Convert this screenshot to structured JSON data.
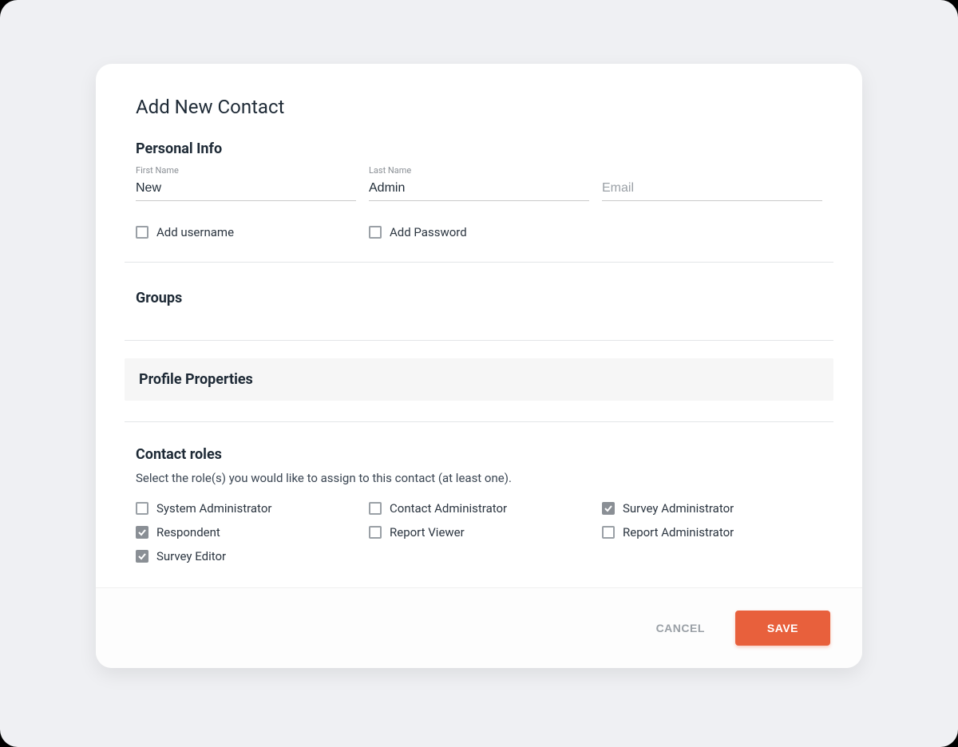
{
  "title": "Add New Contact",
  "sections": {
    "personal_info": "Personal Info",
    "groups": "Groups",
    "profile_properties": "Profile Properties",
    "contact_roles": "Contact roles"
  },
  "fields": {
    "first_name": {
      "label": "First Name",
      "value": "New"
    },
    "last_name": {
      "label": "Last Name",
      "value": "Admin"
    },
    "email": {
      "placeholder": "Email",
      "value": ""
    }
  },
  "options": {
    "add_username": {
      "label": "Add username",
      "checked": false
    },
    "add_password": {
      "label": "Add Password",
      "checked": false
    }
  },
  "roles": {
    "hint": "Select the role(s) you would like to assign to this contact (at least one).",
    "items": [
      {
        "label": "System Administrator",
        "checked": false
      },
      {
        "label": "Contact Administrator",
        "checked": false
      },
      {
        "label": "Survey Administrator",
        "checked": true
      },
      {
        "label": "Respondent",
        "checked": true
      },
      {
        "label": "Report Viewer",
        "checked": false
      },
      {
        "label": "Report Administrator",
        "checked": false
      },
      {
        "label": "Survey Editor",
        "checked": true
      }
    ]
  },
  "footer": {
    "cancel": "CANCEL",
    "save": "SAVE"
  },
  "colors": {
    "accent": "#e8603c"
  }
}
